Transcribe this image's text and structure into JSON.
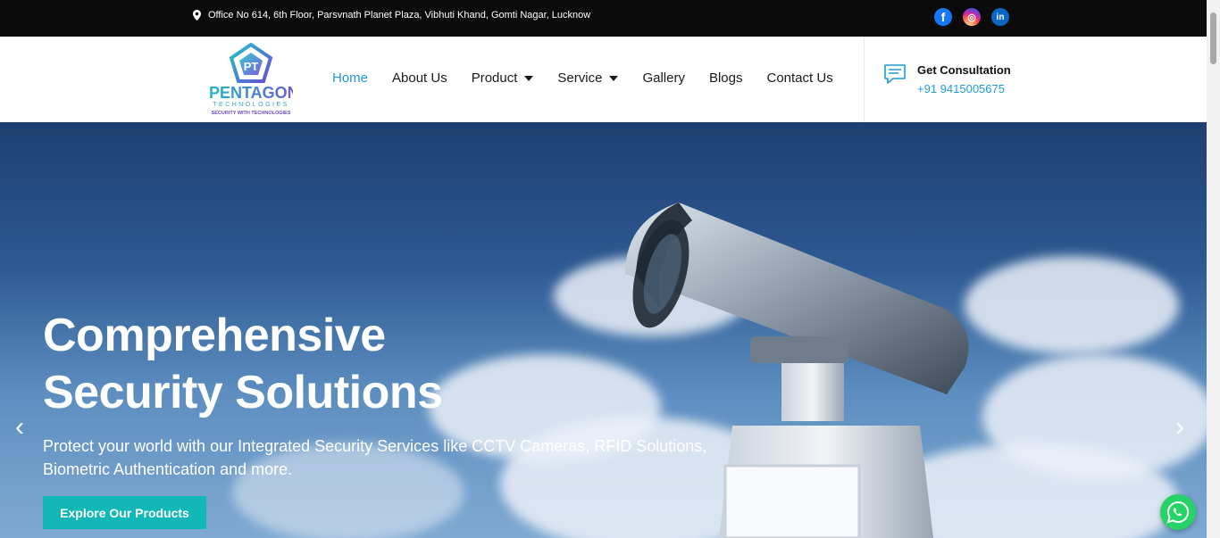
{
  "topbar": {
    "address": "Office No 614, 6th Floor, Parsvnath Planet Plaza, Vibhuti Khand, Gomti Nagar, Lucknow",
    "socials": [
      {
        "name": "facebook",
        "glyph": "f"
      },
      {
        "name": "instagram",
        "glyph": "◎"
      },
      {
        "name": "linkedin",
        "glyph": "in"
      }
    ]
  },
  "header": {
    "logo": {
      "word": "PENTAGON",
      "sub": "TECHNOLOGIES",
      "tagline": "SECURITY WITH TECHNOLOGIES",
      "badge": "PT"
    },
    "nav": [
      {
        "label": "Home",
        "active": true
      },
      {
        "label": "About Us"
      },
      {
        "label": "Product",
        "dropdown": true
      },
      {
        "label": "Service",
        "dropdown": true
      },
      {
        "label": "Gallery"
      },
      {
        "label": "Blogs"
      },
      {
        "label": "Contact Us"
      }
    ],
    "consultation": {
      "title": "Get Consultation",
      "phone": "+91 9415005675"
    }
  },
  "hero": {
    "title_line1": "Comprehensive",
    "title_line2": "Security Solutions",
    "subtitle": "Protect your world with our Integrated Security Services like CCTV Cameras, RFID Solutions, Biometric Authentication and more.",
    "cta": "Explore Our Products",
    "prev": "‹",
    "next": "›"
  },
  "colors": {
    "accent": "#1e9bd7",
    "cta": "#12b8b8",
    "topbar": "#0b0b0b",
    "whatsapp": "#25d366"
  }
}
